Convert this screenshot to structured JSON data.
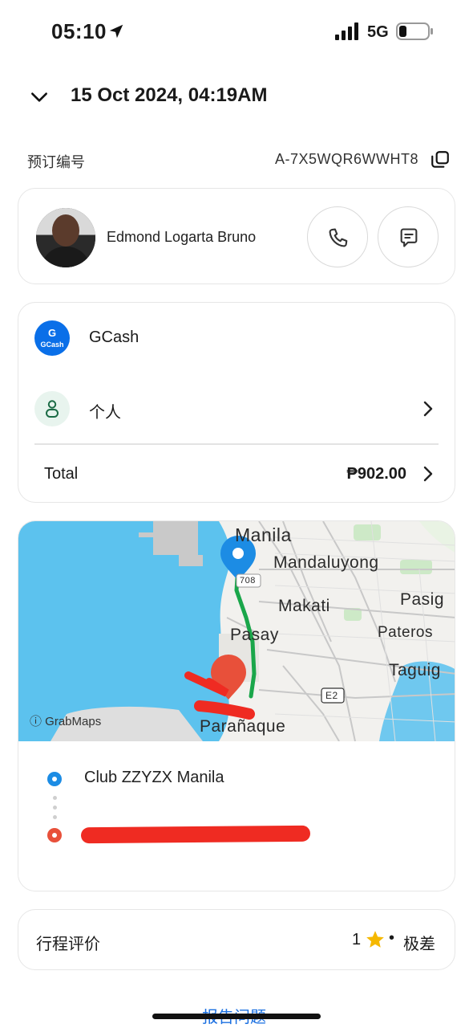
{
  "status_bar": {
    "time": "05:10",
    "network": "5G"
  },
  "header": {
    "date_title": "15 Oct 2024, 04:19AM"
  },
  "booking": {
    "label": "预订编号",
    "id": "A-7X5WQR6WWHT8"
  },
  "driver": {
    "name": "Edmond Logarta Bruno"
  },
  "payment": {
    "method": "GCash",
    "logo_text_top": "G",
    "logo_text_bottom": "GCash",
    "profile": "个人",
    "total_label": "Total",
    "total_amount": "₱902.00"
  },
  "map": {
    "labels": {
      "manila": "Manila",
      "mandaluyong": "Mandaluyong",
      "makati": "Makati",
      "pasig": "Pasig",
      "pasay": "Pasay",
      "pateros": "Pateros",
      "taguig": "Taguig",
      "paranaque": "Parañaque",
      "road_708": "708",
      "road_e2": "E2"
    },
    "attribution": "ⓘ GrabMaps"
  },
  "route": {
    "pickup": "Club ZZYZX Manila"
  },
  "rating": {
    "label": "行程评价",
    "value": "1",
    "separator": "•",
    "text": "极差"
  },
  "footer": {
    "report_link": "报告问题"
  },
  "colors": {
    "accent_blue": "#1a6fe0",
    "gcash_blue": "#0a6fe8",
    "route_green": "#1aa64a",
    "pin_blue": "#1c8ce4",
    "dest_red": "#e8503a",
    "star": "#f5b800"
  }
}
